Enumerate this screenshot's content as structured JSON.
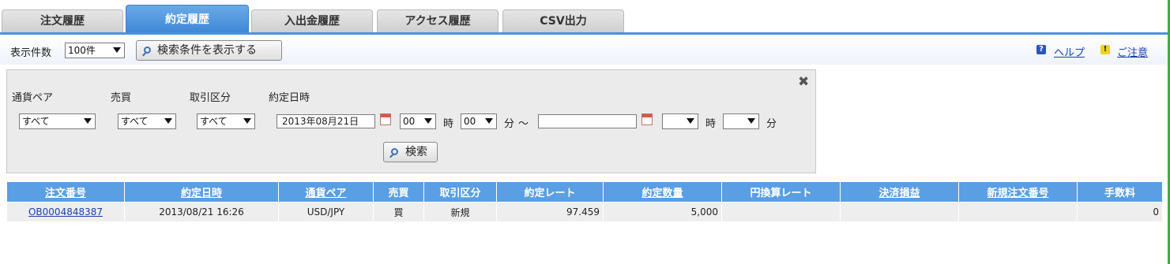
{
  "tabs": [
    {
      "label": "注文履歴",
      "active": false
    },
    {
      "label": "約定履歴",
      "active": true
    },
    {
      "label": "入出金履歴",
      "active": false
    },
    {
      "label": "アクセス履歴",
      "active": false
    },
    {
      "label": "CSV出力",
      "active": false
    }
  ],
  "toolbar": {
    "count_label": "表示件数",
    "count_value": "100件",
    "search_toggle_label": "検索条件を表示する",
    "help_label": "ヘルプ",
    "caution_label": "ご注意"
  },
  "search": {
    "pair_label": "通貨ペア",
    "pair_value": "すべて",
    "side_label": "売買",
    "side_value": "すべて",
    "type_label": "取引区分",
    "type_value": "すべて",
    "date_label": "約定日時",
    "from_date": "2013年08月21日",
    "from_hour": "00",
    "hour_unit": "時",
    "from_minute": "00",
    "minute_unit": "分",
    "tilde": "～",
    "to_date": "",
    "to_hour": "",
    "to_minute": "",
    "search_button": "検索"
  },
  "table": {
    "headers": [
      "注文番号",
      "約定日時",
      "通貨ペア",
      "売買",
      "取引区分",
      "約定レート",
      "約定数量",
      "円換算レート",
      "決済損益",
      "新規注文番号",
      "手数料"
    ],
    "rows": [
      {
        "order_no": "OB0004848387",
        "datetime": "2013/08/21 16:26",
        "pair": "USD/JPY",
        "side": "買",
        "type": "新規",
        "rate": "97.459",
        "quantity": "5,000",
        "yen_rate": "",
        "pl": "",
        "new_order_no": "",
        "fee": "0"
      }
    ]
  },
  "colors": {
    "accent": "#4b92e0",
    "header_bg": "#5a9ee3",
    "buy": "#d8141a",
    "side_bar": "#3bb33b"
  }
}
